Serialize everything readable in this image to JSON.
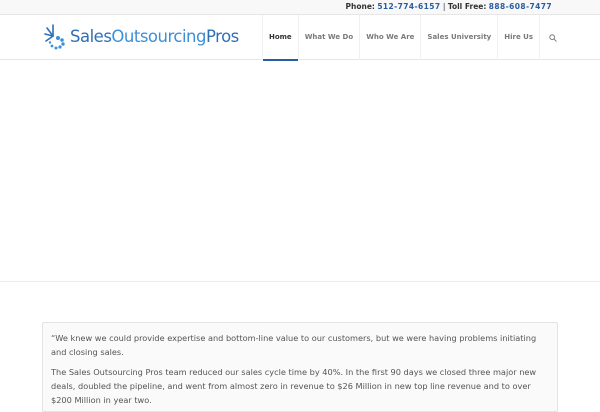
{
  "topbar": {
    "phone_label": "Phone:",
    "phone_number": "512-774-6157",
    "separator": "|",
    "tollfree_label": "Toll Free:",
    "tollfree_number": "888-608-7477"
  },
  "logo": {
    "word1": "Sales",
    "word2": "Outsourcing",
    "word3": "Pros",
    "icon": "sales-logo-mark"
  },
  "nav": {
    "items": [
      {
        "label": "Home",
        "active": true
      },
      {
        "label": "What We Do"
      },
      {
        "label": "Who We Are"
      },
      {
        "label": "Sales University"
      },
      {
        "label": "Hire Us"
      }
    ],
    "search_icon": "search-icon"
  },
  "testimonial": {
    "para1": "“We knew we could provide expertise and bottom-line value to our customers, but we were having problems initiating and closing sales.",
    "para2": "The Sales Outsourcing Pros team reduced our sales cycle time by 40%. In the first 90 days we closed three major new deals, doubled the pipeline, and went from almost zero in revenue to $26 Million in new top line revenue and to over $200 Million in year two."
  },
  "colors": {
    "accent": "#2a5d9f",
    "logo_blue": "#2f6fb6",
    "logo_light_blue": "#3d8fd8"
  }
}
